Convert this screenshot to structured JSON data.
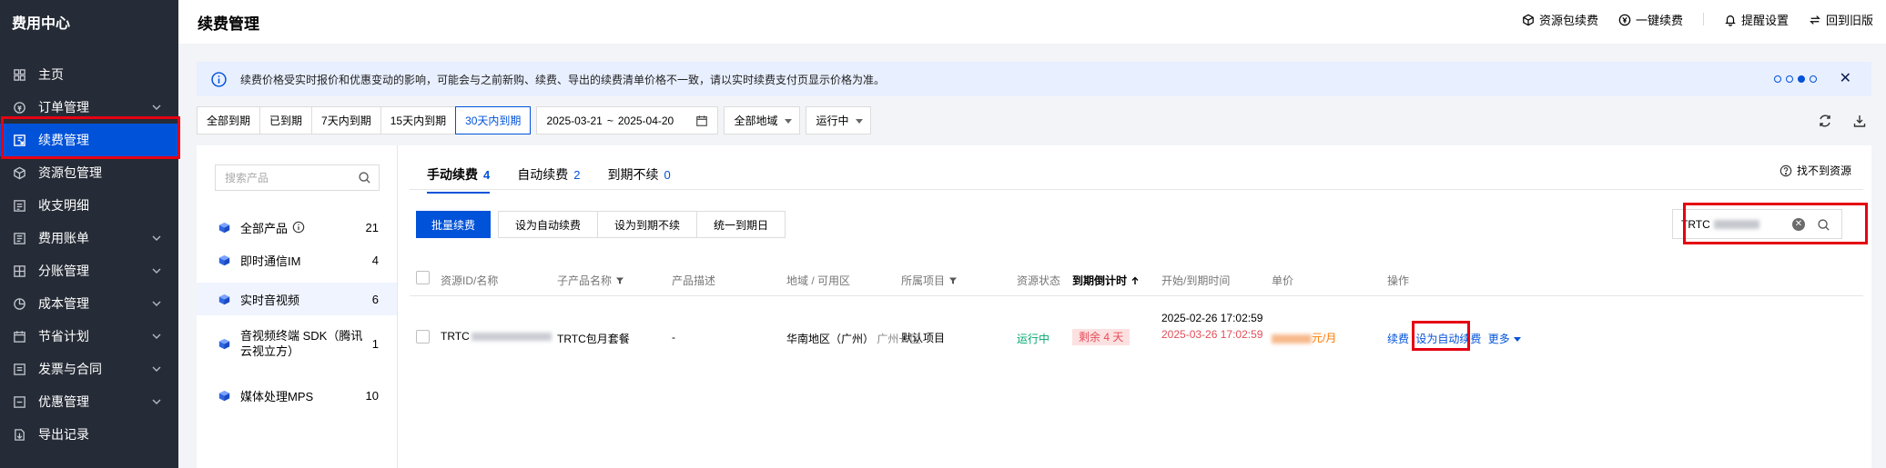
{
  "sidebar": {
    "title": "费用中心",
    "items": [
      {
        "label": "主页",
        "icon": "grid-icon",
        "chevron": false,
        "active": false
      },
      {
        "label": "订单管理",
        "icon": "coin-icon",
        "chevron": true,
        "active": false
      },
      {
        "label": "续费管理",
        "icon": "renew-icon",
        "chevron": false,
        "active": true
      },
      {
        "label": "资源包管理",
        "icon": "cube-icon",
        "chevron": false,
        "active": false
      },
      {
        "label": "收支明细",
        "icon": "list-icon",
        "chevron": false,
        "active": false
      },
      {
        "label": "费用账单",
        "icon": "bill-icon",
        "chevron": true,
        "active": false
      },
      {
        "label": "分账管理",
        "icon": "split-icon",
        "chevron": true,
        "active": false
      },
      {
        "label": "成本管理",
        "icon": "pie-icon",
        "chevron": true,
        "active": false
      },
      {
        "label": "节省计划",
        "icon": "calendar-icon",
        "chevron": true,
        "active": false
      },
      {
        "label": "发票与合同",
        "icon": "invoice-icon",
        "chevron": true,
        "active": false
      },
      {
        "label": "优惠管理",
        "icon": "discount-icon",
        "chevron": true,
        "active": false
      },
      {
        "label": "导出记录",
        "icon": "export-icon",
        "chevron": false,
        "active": false
      }
    ]
  },
  "header": {
    "title": "续费管理",
    "actions": [
      {
        "label": "资源包续费",
        "icon": "cube-icon"
      },
      {
        "label": "一键续费",
        "icon": "yen-icon"
      },
      {
        "label": "提醒设置",
        "icon": "bell-icon"
      },
      {
        "label": "回到旧版",
        "icon": "switch-icon"
      }
    ]
  },
  "notice": {
    "text": "续费价格受实时报价和优惠变动的影响，可能会与之前新购、续费、导出的续费清单价格不一致，请以实时续费支付页显示价格为准。",
    "active_dot": 3,
    "dot_count": 4
  },
  "filters": {
    "periods": [
      "全部到期",
      "已到期",
      "7天内到期",
      "15天内到期",
      "30天内到期"
    ],
    "active_period": 4,
    "date_start": "2025-03-21",
    "date_end": "2025-04-20",
    "date_sep": "~",
    "region": "全部地域",
    "status": "运行中"
  },
  "products": {
    "search_placeholder": "搜索产品",
    "items": [
      {
        "label": "全部产品",
        "count": "21",
        "has_info": true
      },
      {
        "label": "即时通信IM",
        "count": "4"
      },
      {
        "label": "实时音视频",
        "count": "6",
        "active": true
      },
      {
        "label": "音视频终端 SDK（腾讯云视立方）",
        "count": "1"
      },
      {
        "label": "媒体处理MPS",
        "count": "10"
      }
    ]
  },
  "tabs": [
    {
      "label": "手动续费",
      "count": "4",
      "active": true
    },
    {
      "label": "自动续费",
      "count": "2"
    },
    {
      "label": "到期不续",
      "count": "0"
    }
  ],
  "find_resource": "找不到资源",
  "batch_actions": {
    "primary": "批量续费",
    "others": [
      "设为自动续费",
      "设为到期不续",
      "统一到期日"
    ]
  },
  "resource_search": {
    "value": "TRTC"
  },
  "table": {
    "columns": [
      "资源ID/名称",
      "子产品名称",
      "产品描述",
      "地域 / 可用区",
      "所属项目",
      "资源状态",
      "到期倒计时",
      "开始/到期时间",
      "单价",
      "操作"
    ],
    "rows": [
      {
        "id_prefix": "TRTC",
        "sub_product": "TRTC包月套餐",
        "description": "-",
        "region": "华南地区（广州）",
        "zone": "广州一区",
        "project": "默认项目",
        "status": "运行中",
        "countdown": "剩余 4 天",
        "start_time": "2025-02-26 17:02:59",
        "end_time": "2025-03-26 17:02:59",
        "price_unit": "元/月",
        "op_renew": "续费",
        "op_auto": "设为自动续费",
        "op_more": "更多"
      }
    ]
  },
  "colors": {
    "brand": "#0052d9",
    "sidebar": "#262c37",
    "highlight": "#e50012",
    "success": "#00a870",
    "danger": "#e34d59"
  }
}
